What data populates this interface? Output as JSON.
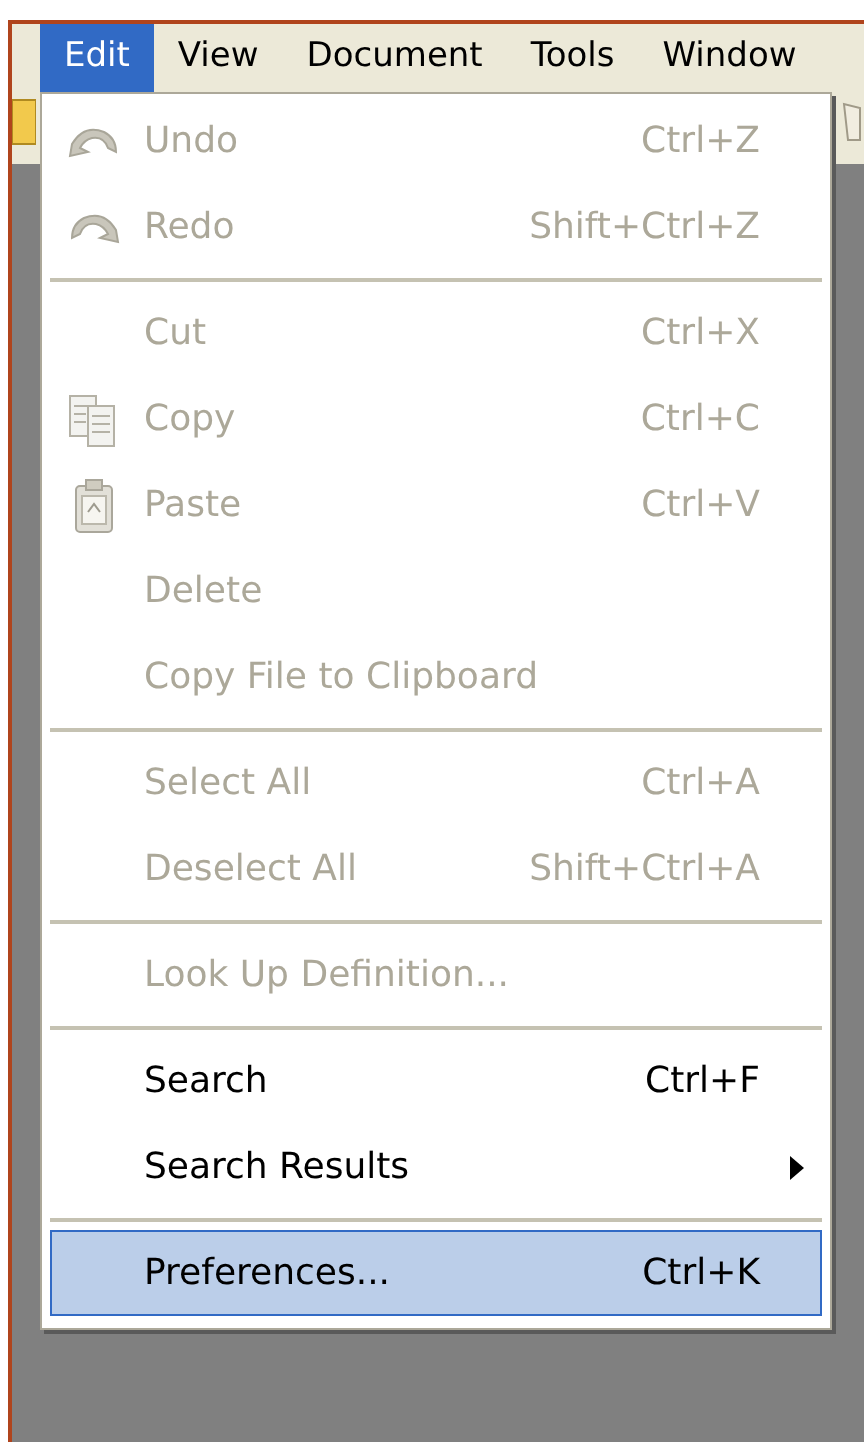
{
  "menubar": [
    {
      "label": "Edit",
      "selected": true
    },
    {
      "label": "View",
      "selected": false
    },
    {
      "label": "Document",
      "selected": false
    },
    {
      "label": "Tools",
      "selected": false
    },
    {
      "label": "Window",
      "selected": false
    }
  ],
  "menu": {
    "items": [
      {
        "kind": "item",
        "label": "Undo",
        "shortcut": "Ctrl+Z",
        "disabled": true,
        "selected": false
      },
      {
        "kind": "item",
        "label": "Redo",
        "shortcut": "Shift+Ctrl+Z",
        "disabled": true,
        "selected": false
      },
      {
        "kind": "separator"
      },
      {
        "kind": "item",
        "label": "Cut",
        "shortcut": "Ctrl+X",
        "disabled": true,
        "selected": false
      },
      {
        "kind": "item",
        "label": "Copy",
        "shortcut": "Ctrl+C",
        "disabled": true,
        "selected": false
      },
      {
        "kind": "item",
        "label": "Paste",
        "shortcut": "Ctrl+V",
        "disabled": true,
        "selected": false
      },
      {
        "kind": "item",
        "label": "Delete",
        "disabled": true,
        "selected": false
      },
      {
        "kind": "item",
        "label": "Copy File to Clipboard",
        "disabled": true,
        "selected": false
      },
      {
        "kind": "separator"
      },
      {
        "kind": "item",
        "label": "Select All",
        "shortcut": "Ctrl+A",
        "disabled": true,
        "selected": false
      },
      {
        "kind": "item",
        "label": "Deselect All",
        "shortcut": "Shift+Ctrl+A",
        "disabled": true,
        "selected": false
      },
      {
        "kind": "separator"
      },
      {
        "kind": "item",
        "label": "Look Up Definition...",
        "disabled": true,
        "selected": false
      },
      {
        "kind": "separator"
      },
      {
        "kind": "item",
        "label": "Search",
        "shortcut": "Ctrl+F",
        "disabled": false,
        "selected": false
      },
      {
        "kind": "item",
        "label": "Search Results",
        "submenu": true,
        "disabled": false,
        "selected": false
      },
      {
        "kind": "separator"
      },
      {
        "kind": "item",
        "label": "Preferences...",
        "shortcut": "Ctrl+K",
        "disabled": false,
        "selected": true
      }
    ]
  }
}
